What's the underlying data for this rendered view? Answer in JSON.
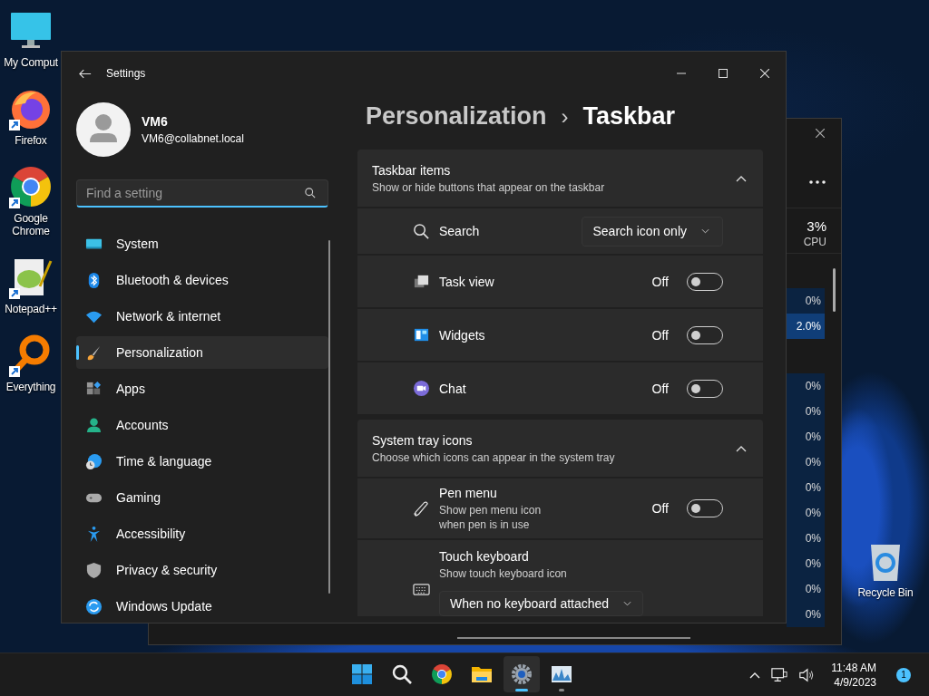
{
  "desktop_icons": [
    {
      "label": "My Comput",
      "kind": "computer",
      "shortcut": false
    },
    {
      "label": "Firefox",
      "kind": "firefox",
      "shortcut": true
    },
    {
      "label": "Google Chrome",
      "kind": "chrome",
      "shortcut": true
    },
    {
      "label": "Notepad++",
      "kind": "notepad",
      "shortcut": true
    },
    {
      "label": "Everything",
      "kind": "everything",
      "shortcut": true
    }
  ],
  "recycle_bin": {
    "label": "Recycle Bin"
  },
  "task_manager": {
    "cpu_percent": "3%",
    "cpu_label": "CPU",
    "groups": [
      {
        "values": [
          {
            "text": "0%",
            "selected": false
          },
          {
            "text": "2.0%",
            "selected": true
          }
        ]
      },
      {
        "values": [
          {
            "text": "0%",
            "selected": false
          },
          {
            "text": "0%",
            "selected": false
          },
          {
            "text": "0%",
            "selected": false
          },
          {
            "text": "0%",
            "selected": false
          },
          {
            "text": "0%",
            "selected": false
          },
          {
            "text": "0%",
            "selected": false
          },
          {
            "text": "0%",
            "selected": false
          },
          {
            "text": "0%",
            "selected": false
          },
          {
            "text": "0%",
            "selected": false
          },
          {
            "text": "0%",
            "selected": false
          }
        ]
      }
    ]
  },
  "settings": {
    "title": "Settings",
    "user": {
      "name": "VM6",
      "email": "VM6@collabnet.local"
    },
    "search": {
      "placeholder": "Find a setting"
    },
    "nav": [
      {
        "label": "System",
        "kind": "system",
        "selected": false
      },
      {
        "label": "Bluetooth & devices",
        "kind": "bluetooth",
        "selected": false
      },
      {
        "label": "Network & internet",
        "kind": "network",
        "selected": false
      },
      {
        "label": "Personalization",
        "kind": "personalization",
        "selected": true
      },
      {
        "label": "Apps",
        "kind": "apps",
        "selected": false
      },
      {
        "label": "Accounts",
        "kind": "accounts",
        "selected": false
      },
      {
        "label": "Time & language",
        "kind": "time",
        "selected": false
      },
      {
        "label": "Gaming",
        "kind": "gaming",
        "selected": false
      },
      {
        "label": "Accessibility",
        "kind": "accessibility",
        "selected": false
      },
      {
        "label": "Privacy & security",
        "kind": "privacy",
        "selected": false
      },
      {
        "label": "Windows Update",
        "kind": "update",
        "selected": false
      }
    ],
    "breadcrumb": {
      "parent": "Personalization",
      "separator": "›",
      "current": "Taskbar"
    },
    "sections": [
      {
        "title": "Taskbar items",
        "subtitle": "Show or hide buttons that appear on the taskbar",
        "expanded": true,
        "items": [
          {
            "label": "Search",
            "kind": "search",
            "value": "Search icon only"
          },
          {
            "label": "Task view",
            "kind": "taskview",
            "state_text": "Off",
            "on": false
          },
          {
            "label": "Widgets",
            "kind": "widgets",
            "state_text": "Off",
            "on": false
          },
          {
            "label": "Chat",
            "kind": "chat",
            "state_text": "Off",
            "on": false
          }
        ]
      },
      {
        "title": "System tray icons",
        "subtitle": "Choose which icons can appear in the system tray",
        "expanded": true,
        "items": [
          {
            "label": "Pen menu",
            "description": "Show pen menu icon when pen is in use",
            "kind": "pen",
            "state_text": "Off",
            "on": false
          },
          {
            "label": "Touch keyboard",
            "description": "Show touch keyboard icon",
            "kind": "keyboard",
            "value": "When no keyboard attached"
          }
        ]
      }
    ]
  },
  "taskbar": {
    "apps": [
      {
        "kind": "start",
        "active": false,
        "running": false
      },
      {
        "kind": "search",
        "active": false,
        "running": false
      },
      {
        "kind": "chrome",
        "active": false,
        "running": false
      },
      {
        "kind": "explorer",
        "active": false,
        "running": false
      },
      {
        "kind": "settings",
        "active": true,
        "running": true
      },
      {
        "kind": "taskmgr",
        "active": false,
        "running": true
      }
    ],
    "time": "11:48 AM",
    "date": "4/9/2023",
    "notifications": "1"
  }
}
